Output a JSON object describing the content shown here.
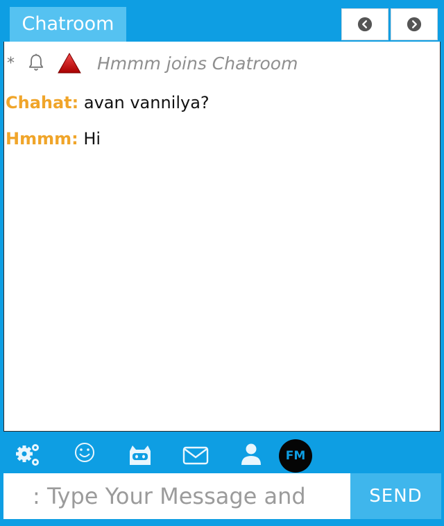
{
  "header": {
    "room_name": "Chatroom",
    "prev_icon": "chevron-left-circle-icon",
    "next_icon": "chevron-right-circle-icon"
  },
  "system_message": {
    "star": "*",
    "text": "Hmmm joins Chatroom"
  },
  "messages": [
    {
      "sender": "Chahat:",
      "text": "avan vannilya?"
    },
    {
      "sender": "Hmmm:",
      "text": "Hi"
    }
  ],
  "toolbar": {
    "icons": [
      "gears-icon",
      "smiley-icon",
      "cat-icon",
      "mail-icon",
      "user-icon",
      "fm-radio-icon"
    ],
    "fm_label": "FM"
  },
  "composer": {
    "placeholder": ": Type Your Message and",
    "send_label": "SEND"
  },
  "colors": {
    "accent": "#0e9ee3",
    "tab": "#55c2f1",
    "sender": "#f0a52a",
    "send_button": "#3fb6ec"
  }
}
